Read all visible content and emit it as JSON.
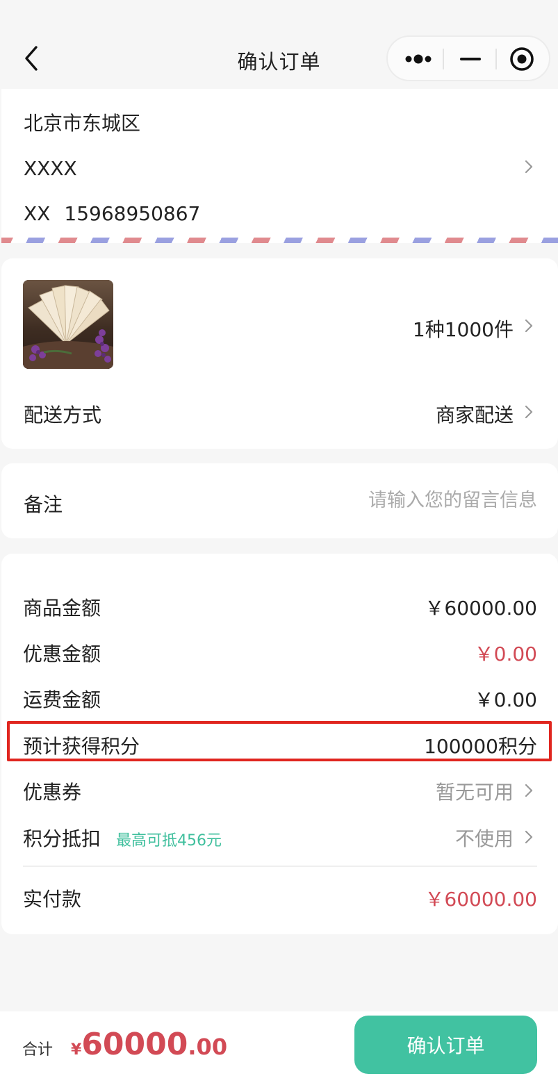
{
  "nav": {
    "title": "确认订单"
  },
  "address": {
    "region": "北京市东城区",
    "detail": "XXXX",
    "name": "XX",
    "phone": "15968950867"
  },
  "goods": {
    "count": "1种1000件",
    "shipping_label": "配送方式",
    "shipping_value": "商家配送"
  },
  "note": {
    "label": "备注",
    "placeholder": "请输入您的留言信息"
  },
  "summary": {
    "goods_amount_label": "商品金额",
    "goods_amount": "￥60000.00",
    "discount_label": "优惠金额",
    "discount": "￥0.00",
    "freight_label": "运费金额",
    "freight": "￥0.00",
    "points_label": "预计获得积分",
    "points": "100000积分",
    "coupon_label": "优惠券",
    "coupon_value": "暂无可用",
    "points_deduct_label": "积分抵扣",
    "points_deduct_tip": "最高可抵456元",
    "points_deduct_value": "不使用",
    "paid_label": "实付款",
    "paid": "￥60000.00"
  },
  "bottom": {
    "total_label": "合计",
    "currency": "¥",
    "total_int": "60000",
    "total_dec": ".00",
    "confirm_label": "确认订单"
  },
  "colors": {
    "accent": "#41c2a1",
    "price_red": "#d24a55",
    "highlight": "#e0261f"
  }
}
